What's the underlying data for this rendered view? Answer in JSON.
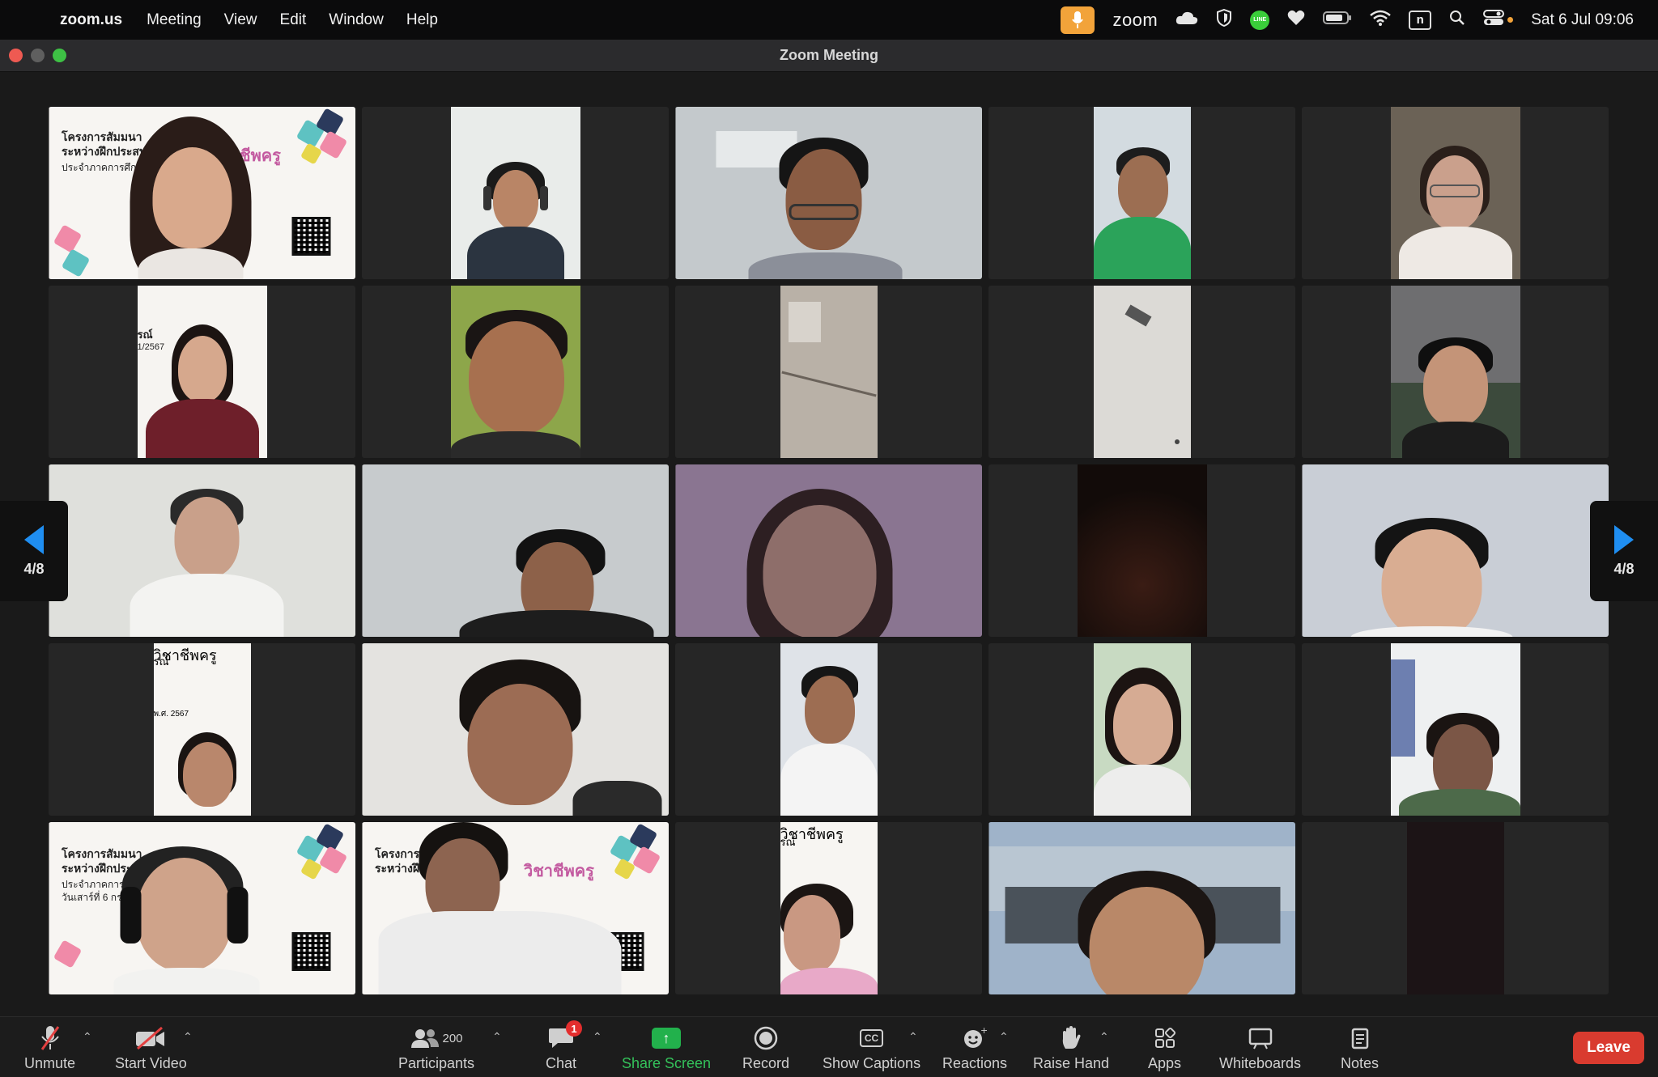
{
  "menubar": {
    "app_name": "zoom.us",
    "items": [
      "Meeting",
      "View",
      "Edit",
      "Window",
      "Help"
    ],
    "zoom_label": "zoom",
    "line_label": "LINE",
    "n_label": "n",
    "datetime": "Sat 6 Jul  09:06"
  },
  "window": {
    "title": "Zoom Meeting"
  },
  "gallery": {
    "page_indicator_left": "4/8",
    "page_indicator_right": "4/8",
    "poster_text": {
      "thai_title": "วิชาชีพครู",
      "line1": "โครงการสัมมนา",
      "line2": "ระหว่างฝึกประสบ",
      "line3": "ประจำภาคการศึกษา",
      "line4": "วันเสาร์ที่ 6 กรกฎ",
      "partial1": "รณ์",
      "partial2": "1/2567",
      "partial3": "พ.ศ. 2567"
    }
  },
  "toolbar": {
    "unmute": "Unmute",
    "start_video": "Start Video",
    "participants": "Participants",
    "participants_count": "200",
    "chat": "Chat",
    "chat_badge": "1",
    "share_screen": "Share Screen",
    "record": "Record",
    "show_captions": "Show Captions",
    "captions_icon_text": "CC",
    "reactions": "Reactions",
    "raise_hand": "Raise Hand",
    "apps": "Apps",
    "whiteboards": "Whiteboards",
    "notes": "Notes",
    "leave": "Leave"
  },
  "colors": {
    "accent_blue": "#1f8ef1",
    "share_green": "#22b14c",
    "leave_red": "#d93b2f",
    "mic_orange": "#f2a33a"
  }
}
